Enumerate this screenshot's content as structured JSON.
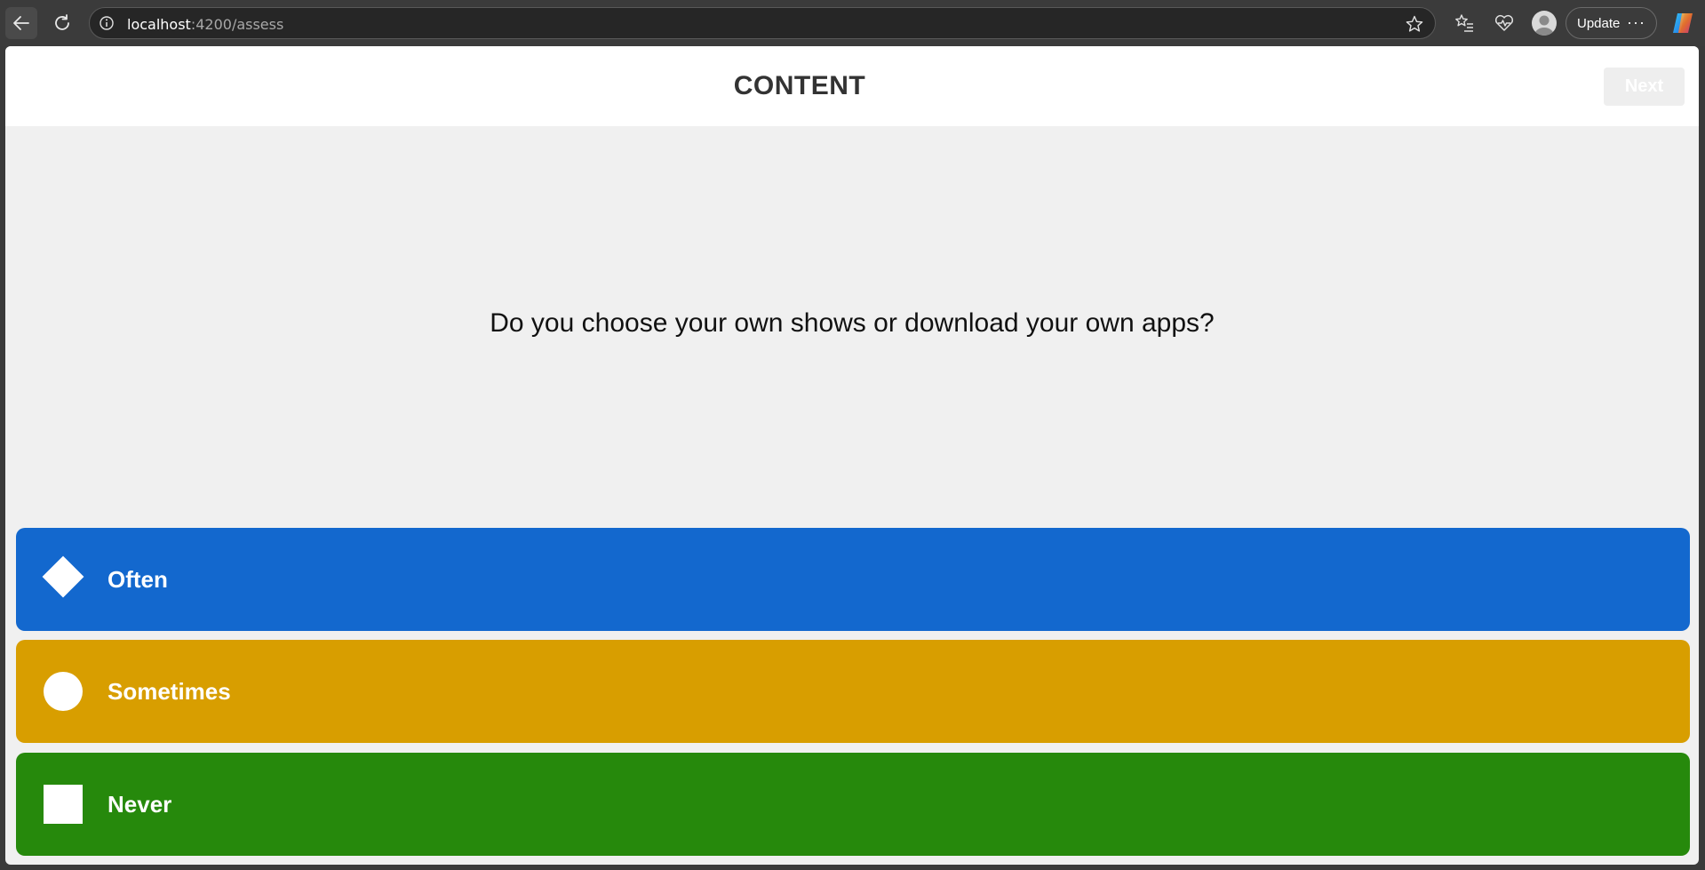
{
  "browser": {
    "url_host": "localhost",
    "url_rest": ":4200/assess",
    "update_label": "Update",
    "more_label": "···",
    "icons": [
      "back-arrow-icon",
      "reload-icon",
      "site-info-icon",
      "favorite-star-icon",
      "favorites-list-icon",
      "browser-essentials-icon",
      "profile-avatar-icon",
      "more-icon",
      "copilot-icon"
    ]
  },
  "header": {
    "title": "CONTENT",
    "next_label": "Next"
  },
  "question": {
    "text": "Do you choose your own shows or download your own apps?"
  },
  "answers": [
    {
      "label": "Often",
      "shape": "diamond-icon",
      "color": "#1368ce"
    },
    {
      "label": "Sometimes",
      "shape": "circle-icon",
      "color": "#d89e00"
    },
    {
      "label": "Never",
      "shape": "square-icon",
      "color": "#26890c"
    }
  ]
}
